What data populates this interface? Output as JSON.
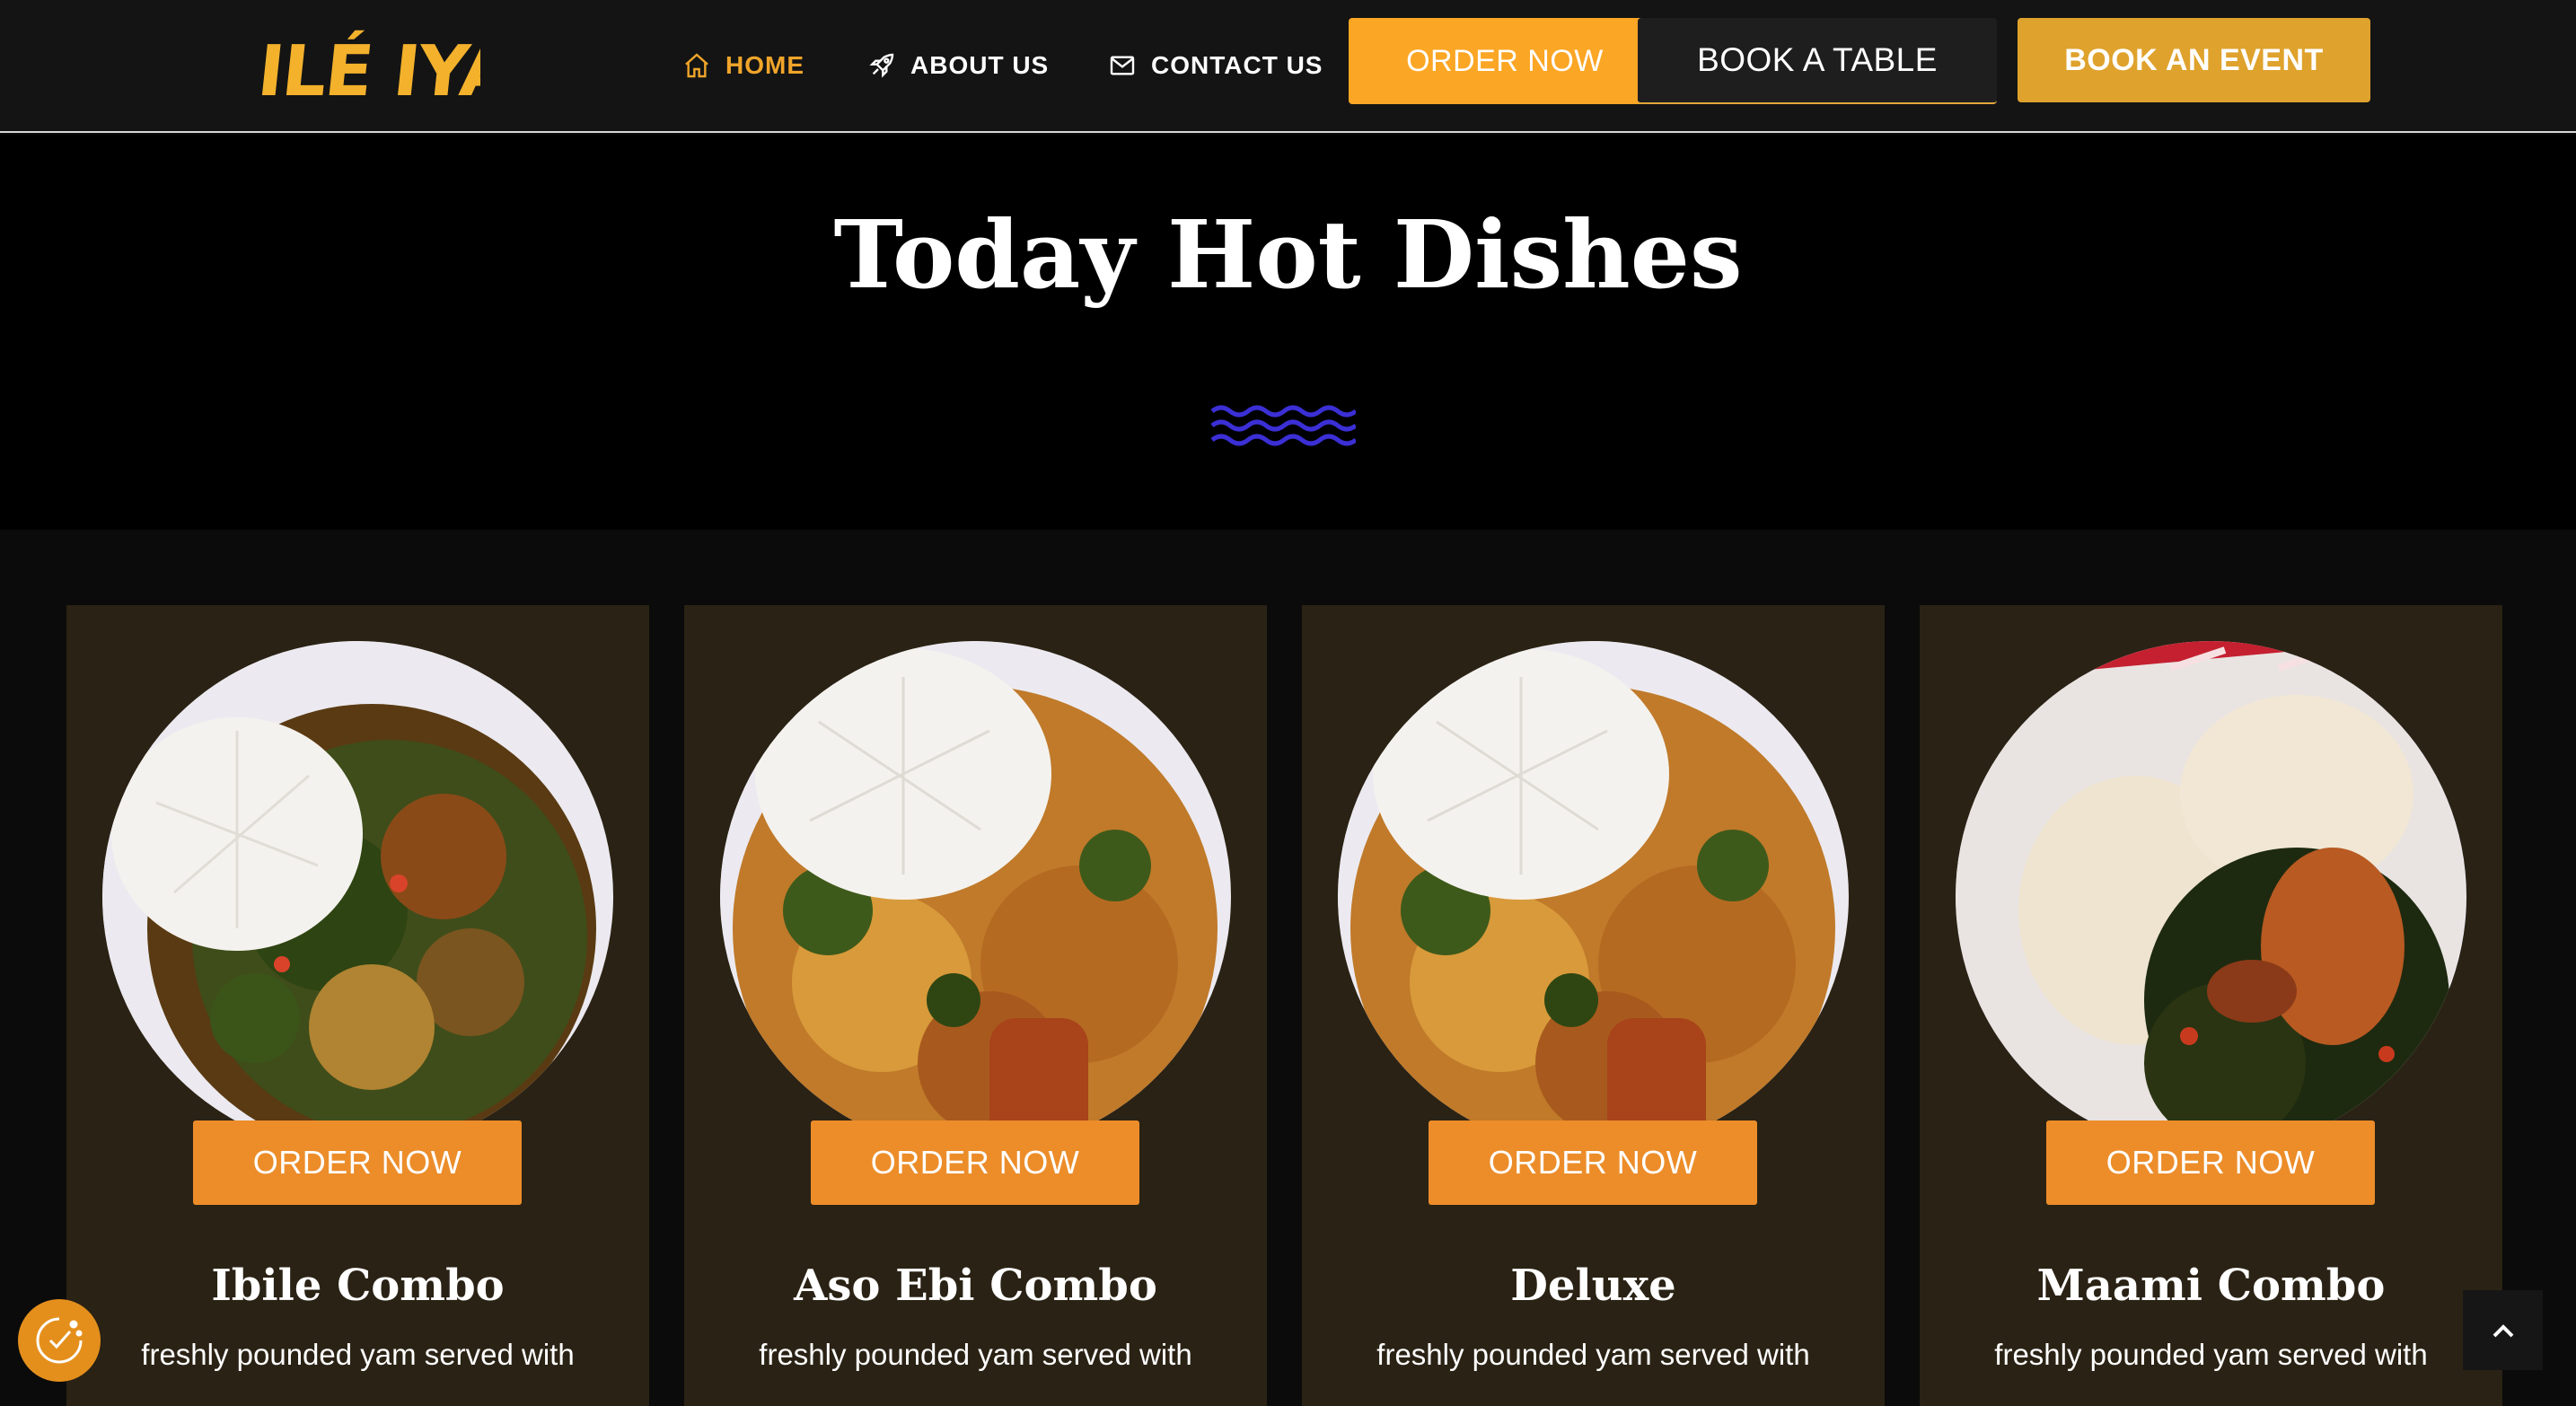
{
  "header": {
    "logo_text": "ILÉ IYÁN",
    "nav": [
      {
        "label": "HOME",
        "icon": "home-icon",
        "active": true
      },
      {
        "label": "ABOUT US",
        "icon": "rocket-icon",
        "active": false
      },
      {
        "label": "CONTACT US",
        "icon": "envelope-icon",
        "active": false
      }
    ],
    "order_now": "ORDER NOW",
    "book_table": "BOOK A TABLE",
    "book_event": "BOOK AN EVENT"
  },
  "hero": {
    "title": "Today Hot Dishes",
    "divider": "wave-divider-icon"
  },
  "dishes": [
    {
      "name": "Ibile Combo",
      "button": "ORDER NOW",
      "description": "freshly pounded yam served with"
    },
    {
      "name": "Aso Ebi Combo",
      "button": "ORDER NOW",
      "description": "freshly pounded yam served with"
    },
    {
      "name": "Deluxe",
      "button": "ORDER NOW",
      "description": "freshly pounded yam served with"
    },
    {
      "name": "Maami Combo",
      "button": "ORDER NOW",
      "description": "freshly pounded yam served with"
    }
  ],
  "colors": {
    "accent": "#fba624",
    "card_button": "#ec8d2a",
    "card_bg": "#2a2214",
    "wave": "#3b2fd6"
  },
  "floating": {
    "cookie_icon": "cookie-consent-icon",
    "scroll_top_icon": "chevron-up-icon"
  }
}
